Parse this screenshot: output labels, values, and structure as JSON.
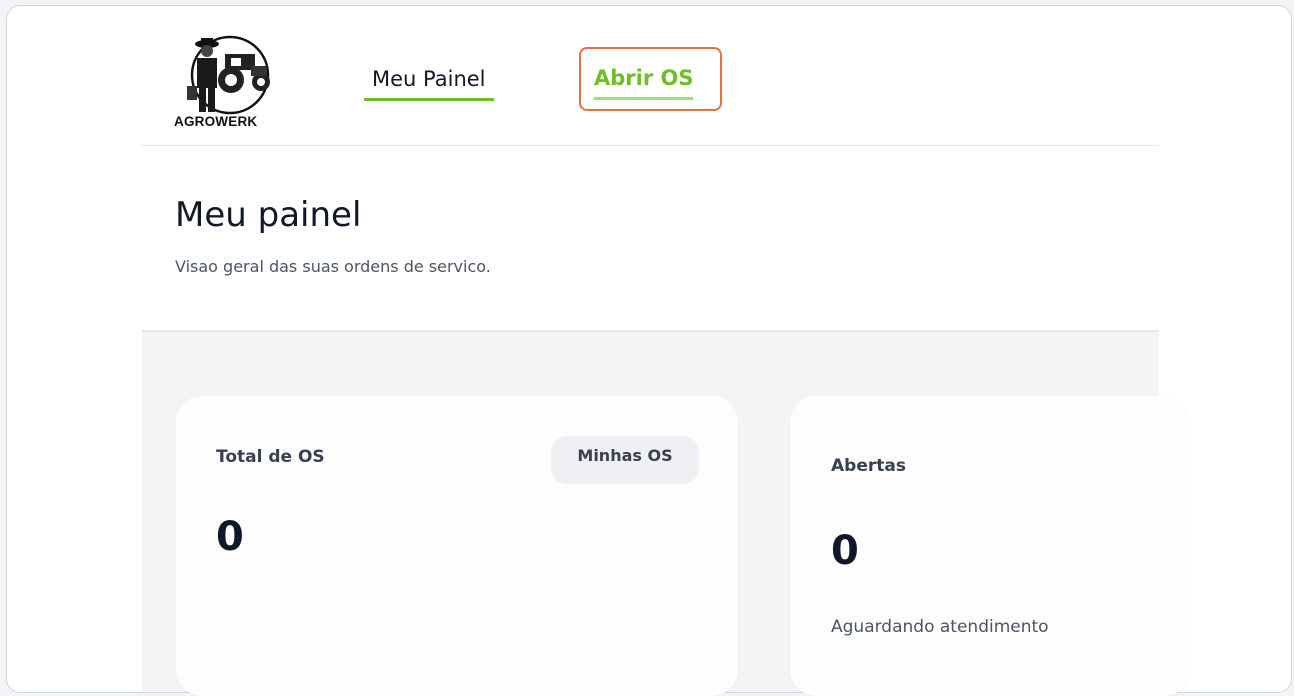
{
  "brand": {
    "logo_text": "AGROWERK"
  },
  "nav": {
    "items": [
      {
        "label": "Meu Painel"
      },
      {
        "label": "Abrir OS"
      }
    ],
    "accent_color": "#6cc024",
    "highlight_color": "#e9703b"
  },
  "header": {
    "title": "Meu painel",
    "subtitle": "Visao geral das suas ordens de servico."
  },
  "cards": [
    {
      "label": "Total de OS",
      "badge": "Minhas OS",
      "value": "0"
    },
    {
      "label": "Abertas",
      "value": "0",
      "note": "Aguardando atendimento"
    }
  ]
}
